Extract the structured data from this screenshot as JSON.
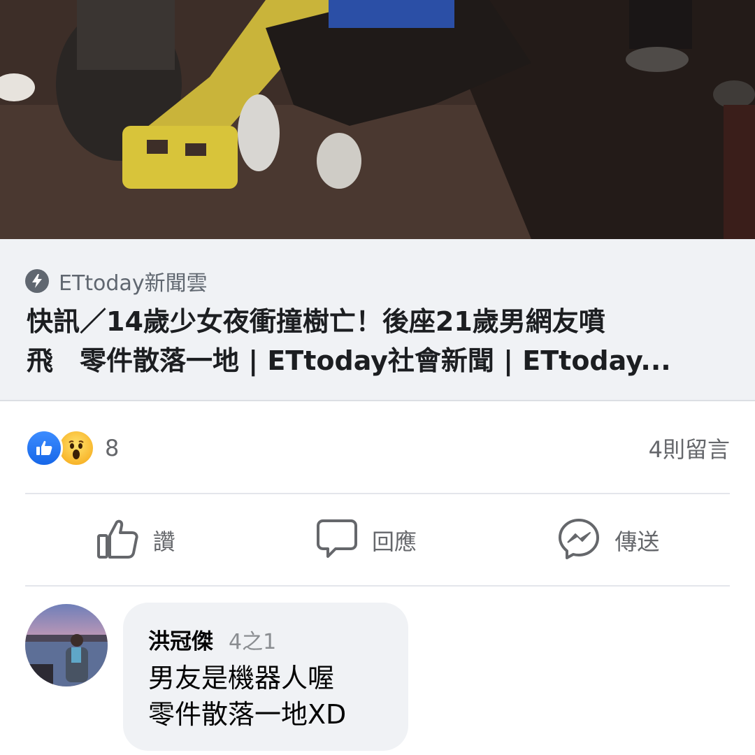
{
  "photo": {
    "description_icon": "news-photo"
  },
  "link_preview": {
    "source_icon": "bolt-icon",
    "source_name": "ETtoday新聞雲",
    "headline": "快訊／14歲少女夜衝撞樹亡！後座21歲男網友噴\n飛　零件散落一地 | ETtoday社會新聞 | ETtoday..."
  },
  "reactions": {
    "icons": [
      "like-reaction-icon",
      "wow-reaction-icon"
    ],
    "count": "8",
    "comments_label": "4則留言"
  },
  "actions": {
    "like_label": "讚",
    "comment_label": "回應",
    "share_label": "傳送"
  },
  "comment": {
    "author": "洪冠傑",
    "page_indicator": "4之1",
    "text": "男友是機器人喔\n零件散落一地XD"
  },
  "colors": {
    "accent_blue": "#1877f2",
    "wow_yellow": "#f7b125",
    "muted_text": "#65676b",
    "preview_bg": "#f0f2f5"
  }
}
